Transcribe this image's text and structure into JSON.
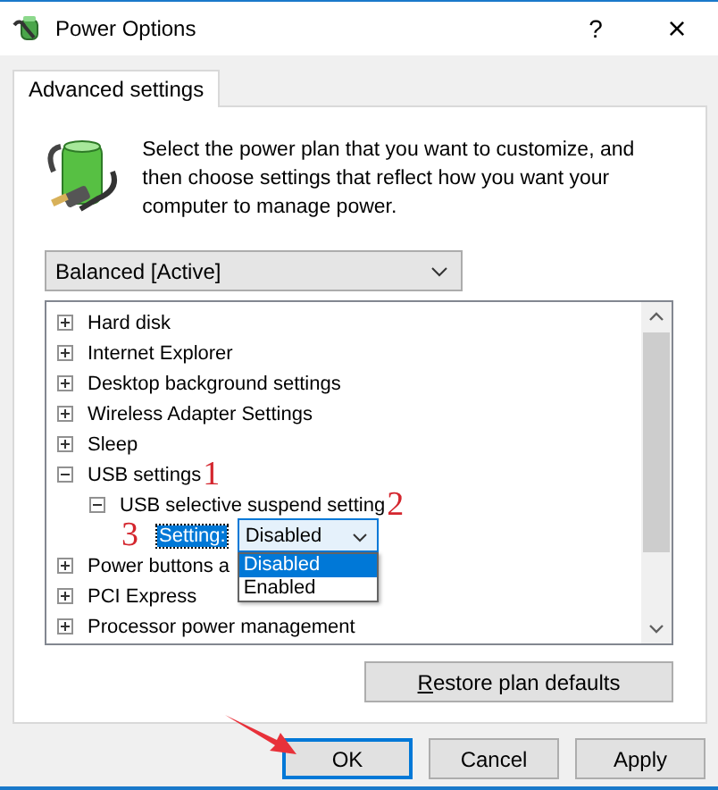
{
  "window": {
    "title": "Power Options",
    "help": "?",
    "close": "×"
  },
  "tabs": [
    {
      "label": "Advanced settings",
      "selected": true
    }
  ],
  "description": "Select the power plan that you want to customize, and then choose settings that reflect how you want your computer to manage power.",
  "plan_select": {
    "value": "Balanced [Active]"
  },
  "tree": {
    "items": [
      {
        "label": "Hard disk",
        "expanded": false
      },
      {
        "label": "Internet Explorer",
        "expanded": false
      },
      {
        "label": "Desktop background settings",
        "expanded": false
      },
      {
        "label": "Wireless Adapter Settings",
        "expanded": false
      },
      {
        "label": "Sleep",
        "expanded": false
      },
      {
        "label": "USB settings",
        "expanded": true,
        "annotation": "1",
        "children": [
          {
            "label": "USB selective suspend setting",
            "expanded": true,
            "annotation": "2",
            "children": [
              {
                "kind": "setting",
                "label": "Setting:",
                "value": "Disabled",
                "annotation": "3",
                "options": [
                  {
                    "label": "Disabled",
                    "selected": true
                  },
                  {
                    "label": "Enabled",
                    "selected": false
                  }
                ]
              }
            ]
          }
        ]
      },
      {
        "label": "Power buttons a",
        "expanded": false
      },
      {
        "label": "PCI Express",
        "expanded": false
      },
      {
        "label": "Processor power management",
        "expanded": false
      }
    ]
  },
  "restore_button": {
    "label": "Restore plan defaults"
  },
  "buttons": [
    {
      "label": "OK",
      "default": true,
      "arrow": true
    },
    {
      "label": "Cancel",
      "default": false,
      "arrow": false
    },
    {
      "label": "Apply",
      "default": false,
      "arrow": false
    }
  ]
}
